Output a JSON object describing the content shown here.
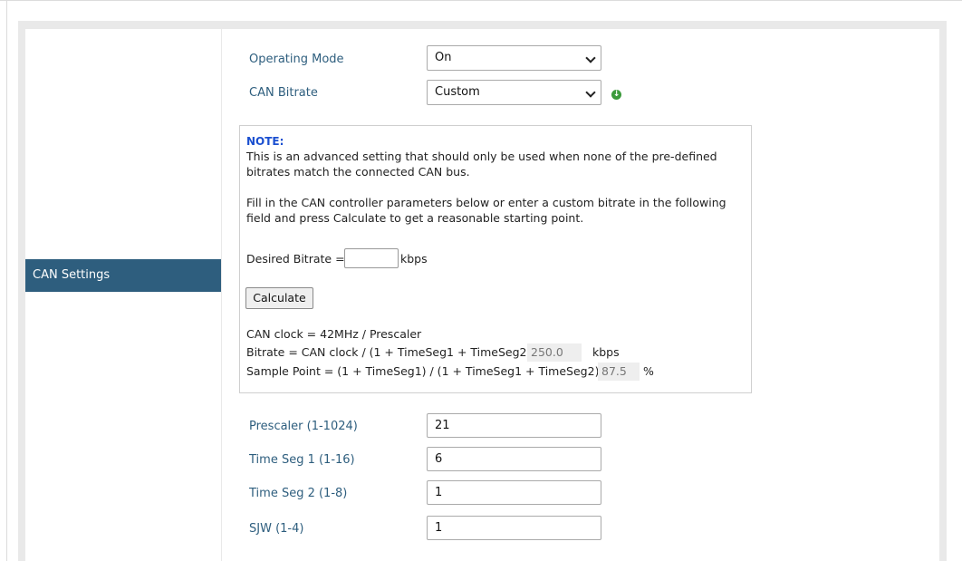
{
  "sidebar": {
    "items": [
      {
        "label": "CAN Settings"
      }
    ]
  },
  "form": {
    "operating_mode": {
      "label": "Operating Mode",
      "value": "On"
    },
    "can_bitrate": {
      "label": "CAN Bitrate",
      "value": "Custom"
    },
    "prescaler": {
      "label": "Prescaler (1-1024)",
      "value": "21"
    },
    "time_seg1": {
      "label": "Time Seg 1 (1-16)",
      "value": "6"
    },
    "time_seg2": {
      "label": "Time Seg 2 (1-8)",
      "value": "1"
    },
    "sjw": {
      "label": "SJW (1-4)",
      "value": "1"
    }
  },
  "note": {
    "title": "NOTE:",
    "line1": "This is an advanced setting that should only be used when none of the pre-defined",
    "line2": "bitrates match the connected CAN bus.",
    "line3": "Fill in the CAN controller parameters below or enter a custom bitrate in the following",
    "line4": "field and press Calculate to get a reasonable starting point.",
    "desired_label": "Desired Bitrate =",
    "desired_value": "",
    "desired_unit": "kbps",
    "calculate_label": "Calculate",
    "clock_line": "CAN clock = 42MHz / Prescaler",
    "bitrate_formula": "Bitrate = CAN clock / (1 + TimeSeg1 + TimeSeg2) =",
    "bitrate_value": "250.0",
    "bitrate_unit": "kbps",
    "sample_formula": "Sample Point = (1 + TimeSeg1) / (1 + TimeSeg1 + TimeSeg2) =",
    "sample_value": "87.5",
    "sample_unit": "%"
  },
  "icons": {
    "info": "info-icon"
  },
  "colors": {
    "sidebar_active": "#2e5e7e",
    "label": "#2e5e7e",
    "note_title": "#1a4fd0",
    "info": "#3c9a3c"
  }
}
